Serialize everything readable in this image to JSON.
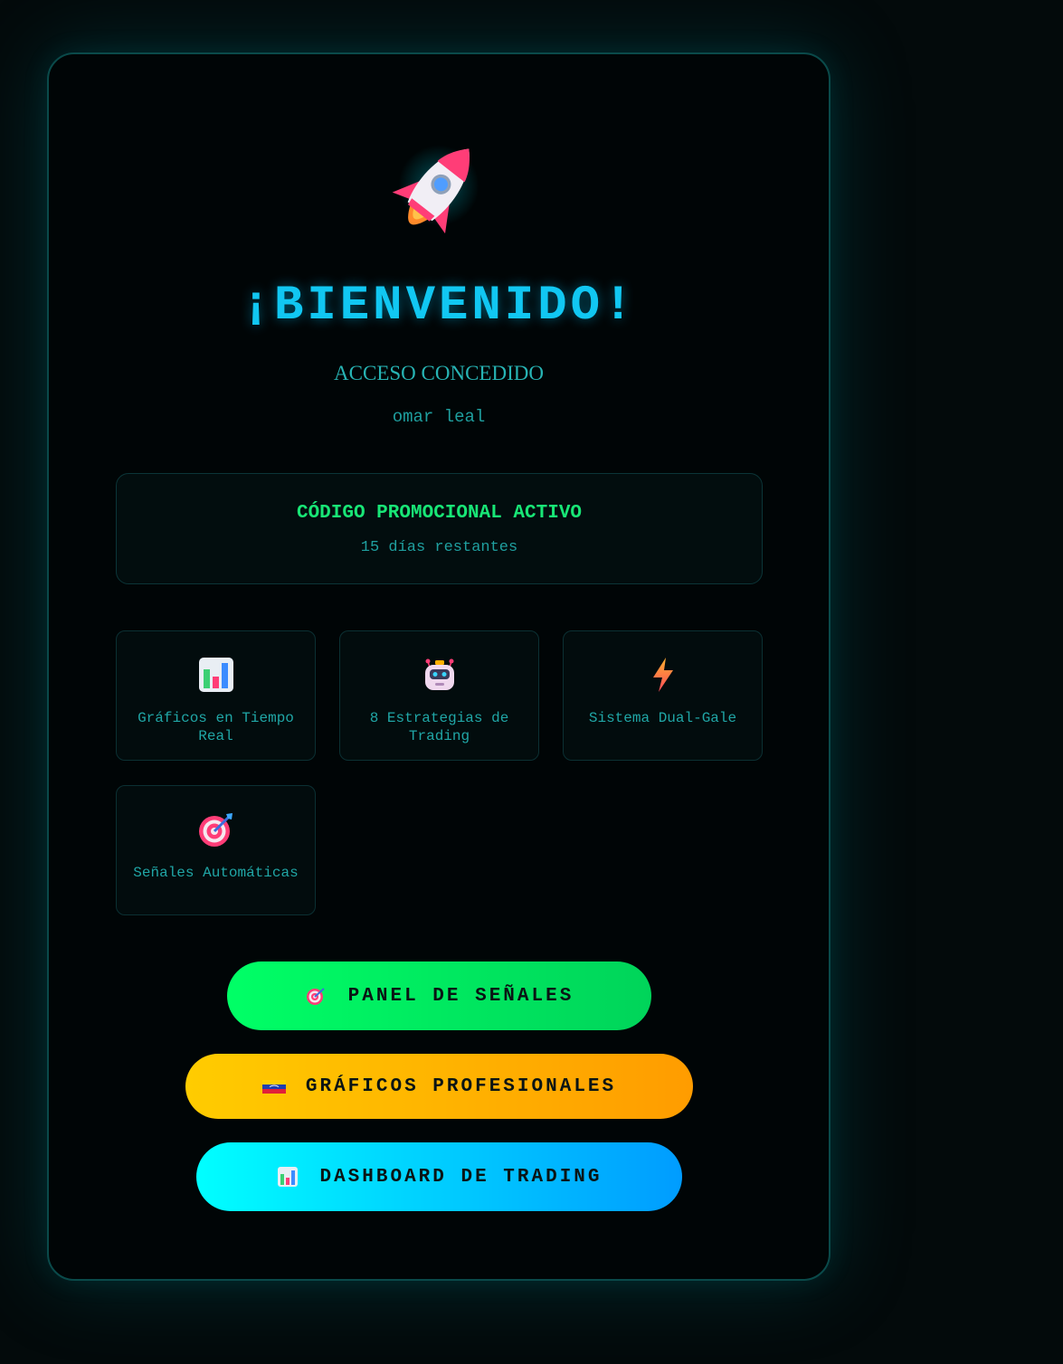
{
  "hero": {
    "icon": "rocket-icon",
    "title": "¡BIENVENIDO!",
    "subtitle": "ACCESO CONCEDIDO",
    "username": "omar leal"
  },
  "promo": {
    "title": "CÓDIGO PROMOCIONAL ACTIVO",
    "days_remaining": "15 días restantes"
  },
  "features": [
    {
      "icon": "bar-chart-icon",
      "label": "Gráficos en Tiempo Real"
    },
    {
      "icon": "robot-icon",
      "label": "8 Estrategias de Trading"
    },
    {
      "icon": "lightning-icon",
      "label": "Sistema Dual-Gale"
    },
    {
      "icon": "target-icon",
      "label": "Señales Automáticas"
    }
  ],
  "buttons": {
    "signals": {
      "icon": "target-icon",
      "label": "PANEL DE SEÑALES"
    },
    "charts": {
      "icon": "venezuela-flag-icon",
      "label": "GRÁFICOS PROFESIONALES"
    },
    "dashboard": {
      "icon": "bar-chart-icon",
      "label": "DASHBOARD DE TRADING"
    }
  },
  "colors": {
    "background": "#000506",
    "accent_cyan": "#11c7f2",
    "promo_green": "#18e676",
    "text_teal": "#20a6a6",
    "btn_green": "#00ff66",
    "btn_orange": "#ffb000",
    "btn_cyan": "#00d0ff"
  }
}
